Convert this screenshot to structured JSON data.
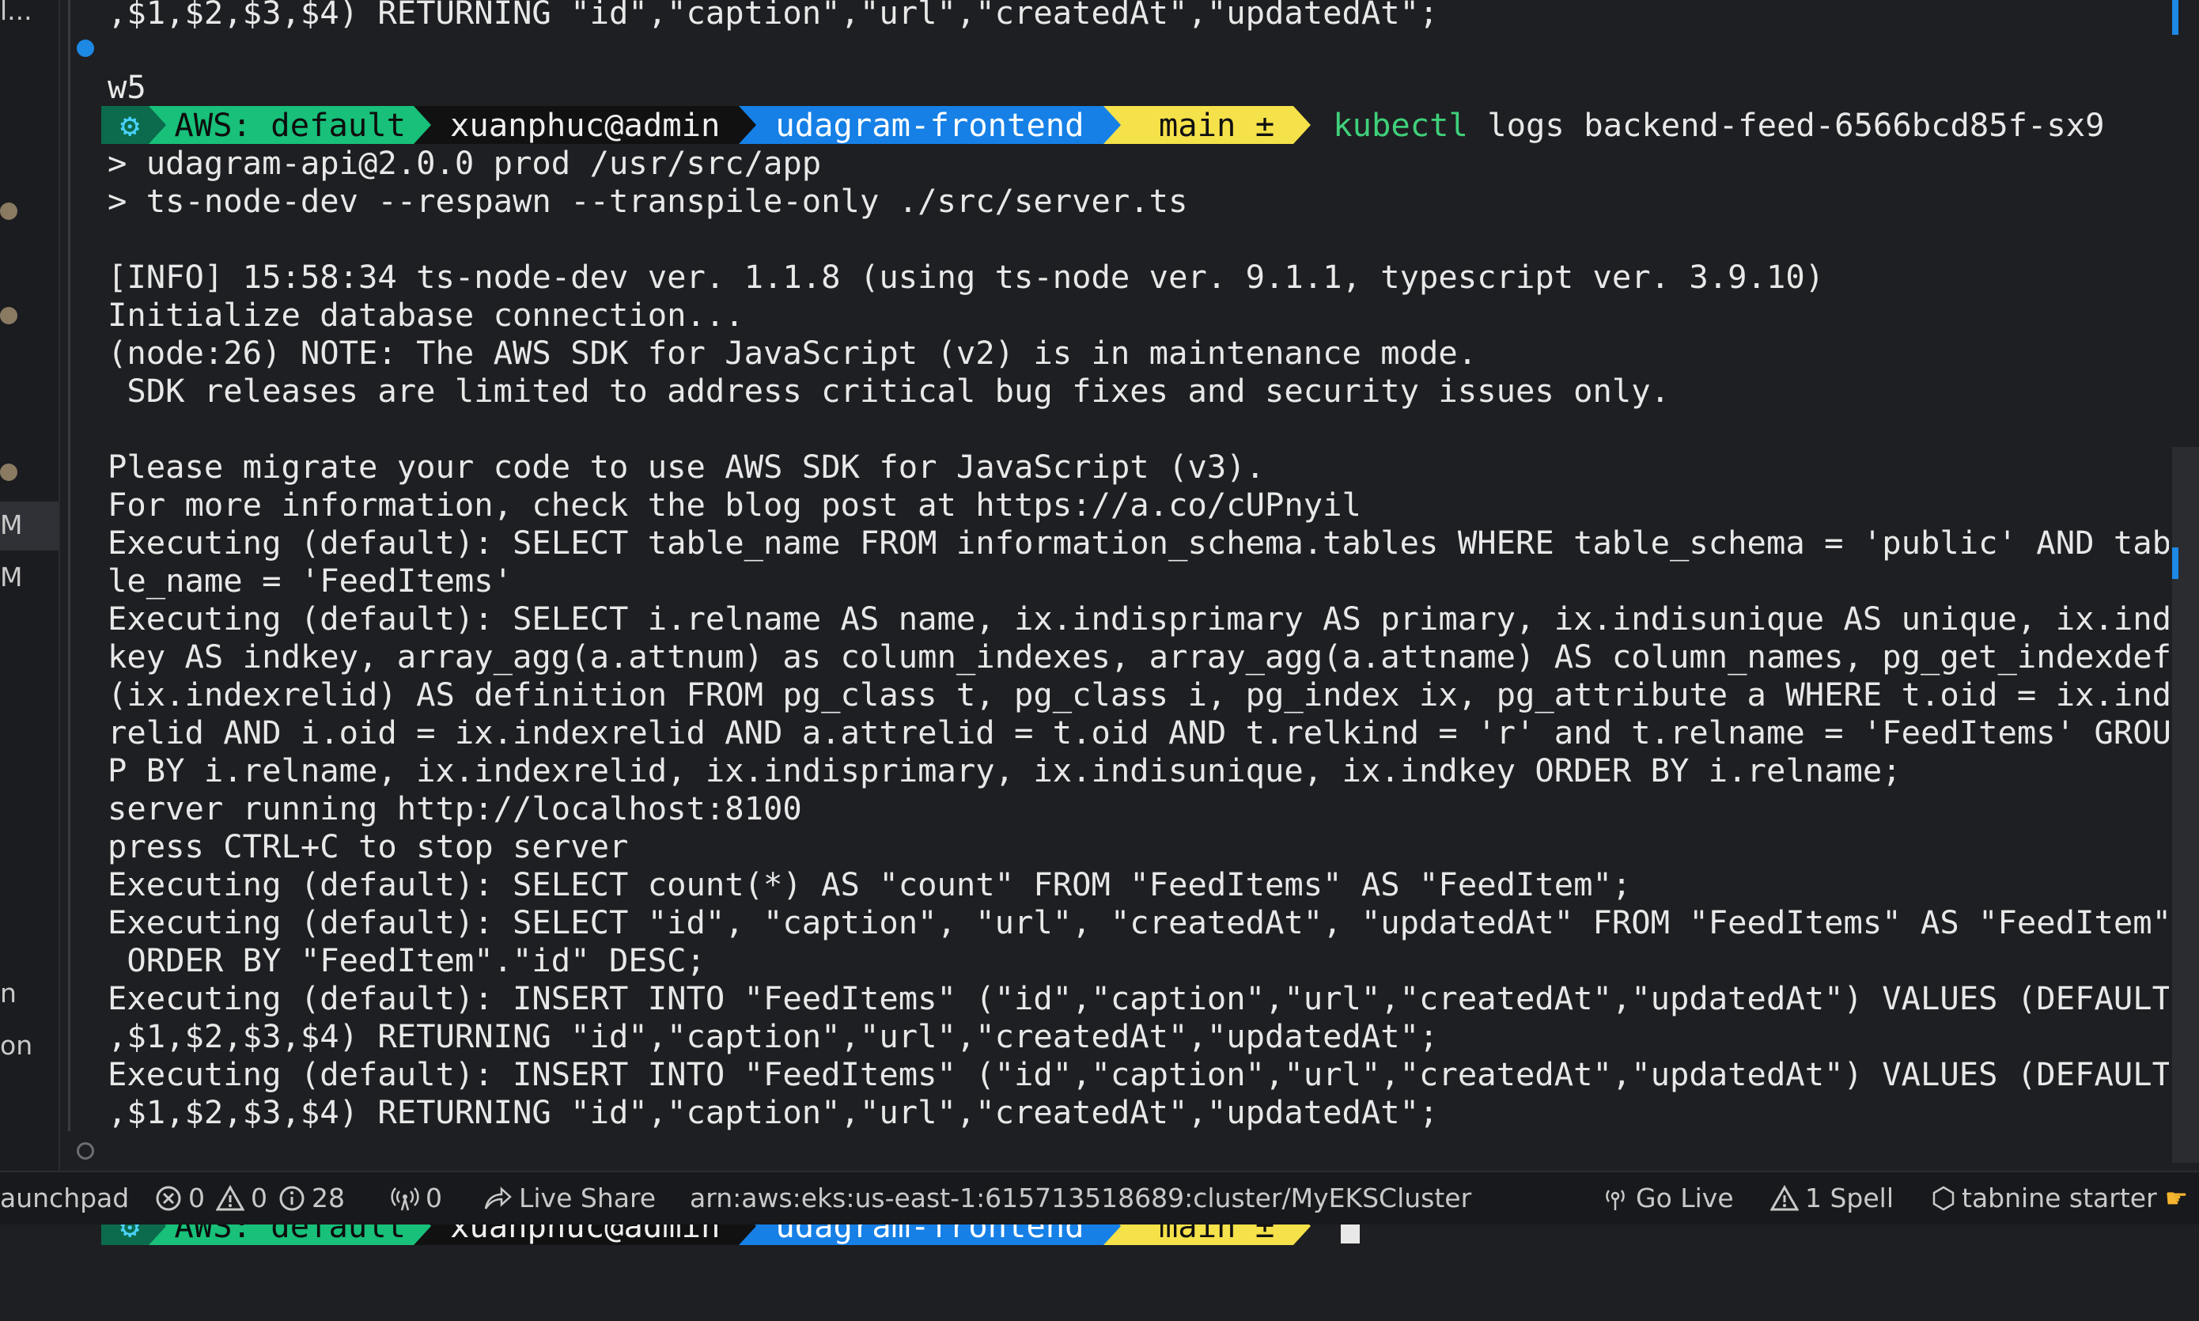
{
  "sidebar": {
    "top_text": "l...",
    "row_labels": [
      "M",
      "M",
      "n",
      "on"
    ]
  },
  "terminal": {
    "lines": [
      ",$1,$2,$3,$4) RETURNING \"id\",\"caption\",\"url\",\"createdAt\",\"updatedAt\";",
      null,
      "w5",
      "",
      "> udagram-api@2.0.0 prod /usr/src/app",
      "> ts-node-dev --respawn --transpile-only ./src/server.ts",
      "",
      "[INFO] 15:58:34 ts-node-dev ver. 1.1.8 (using ts-node ver. 9.1.1, typescript ver. 3.9.10)",
      "Initialize database connection...",
      "(node:26) NOTE: The AWS SDK for JavaScript (v2) is in maintenance mode.",
      " SDK releases are limited to address critical bug fixes and security issues only.",
      "",
      "Please migrate your code to use AWS SDK for JavaScript (v3).",
      "For more information, check the blog post at https://a.co/cUPnyil",
      "Executing (default): SELECT table_name FROM information_schema.tables WHERE table_schema = 'public' AND tab",
      "le_name = 'FeedItems'",
      "Executing (default): SELECT i.relname AS name, ix.indisprimary AS primary, ix.indisunique AS unique, ix.ind",
      "key AS indkey, array_agg(a.attnum) as column_indexes, array_agg(a.attname) AS column_names, pg_get_indexdef",
      "(ix.indexrelid) AS definition FROM pg_class t, pg_class i, pg_index ix, pg_attribute a WHERE t.oid = ix.ind",
      "relid AND i.oid = ix.indexrelid AND a.attrelid = t.oid AND t.relkind = 'r' and t.relname = 'FeedItems' GROU",
      "P BY i.relname, ix.indexrelid, ix.indisprimary, ix.indisunique, ix.indkey ORDER BY i.relname;",
      "server running http://localhost:8100",
      "press CTRL+C to stop server",
      "Executing (default): SELECT count(*) AS \"count\" FROM \"FeedItems\" AS \"FeedItem\";",
      "Executing (default): SELECT \"id\", \"caption\", \"url\", \"createdAt\", \"updatedAt\" FROM \"FeedItems\" AS \"FeedItem\"",
      " ORDER BY \"FeedItem\".\"id\" DESC;",
      "Executing (default): INSERT INTO \"FeedItems\" (\"id\",\"caption\",\"url\",\"createdAt\",\"updatedAt\") VALUES (DEFAULT",
      ",$1,$2,$3,$4) RETURNING \"id\",\"caption\",\"url\",\"createdAt\",\"updatedAt\";",
      "Executing (default): INSERT INTO \"FeedItems\" (\"id\",\"caption\",\"url\",\"createdAt\",\"updatedAt\") VALUES (DEFAULT",
      ",$1,$2,$3,$4) RETURNING \"id\",\"caption\",\"url\",\"createdAt\",\"updatedAt\";"
    ],
    "prompt": {
      "gear_icon": "⚙",
      "aws": "AWS: default",
      "user": "xuanphuc@admin",
      "dir": "udagram-frontend",
      "git": " main ±"
    },
    "command": {
      "keyword": "kubectl",
      "args": " logs backend-feed-6566bcd85f-sx9"
    }
  },
  "statusbar": {
    "launchpad": "aunchpad",
    "errors": "0",
    "warnings": "0",
    "infos": "28",
    "ports": "0",
    "live_share": "Live Share",
    "cluster": "arn:aws:eks:us-east-1:615713518689:cluster/MyEKSCluster",
    "go_live": "Go Live",
    "spell": "1 Spell",
    "tabnine": "tabnine starter"
  },
  "colors": {
    "background": "#1e1f22",
    "text": "#e8e8e8",
    "kubectl": "#3fd07a",
    "aws_segment": "#18c07a",
    "dir_segment": "#1680e6",
    "git_segment": "#f5e14a",
    "accent_mark": "#1e88e5"
  }
}
